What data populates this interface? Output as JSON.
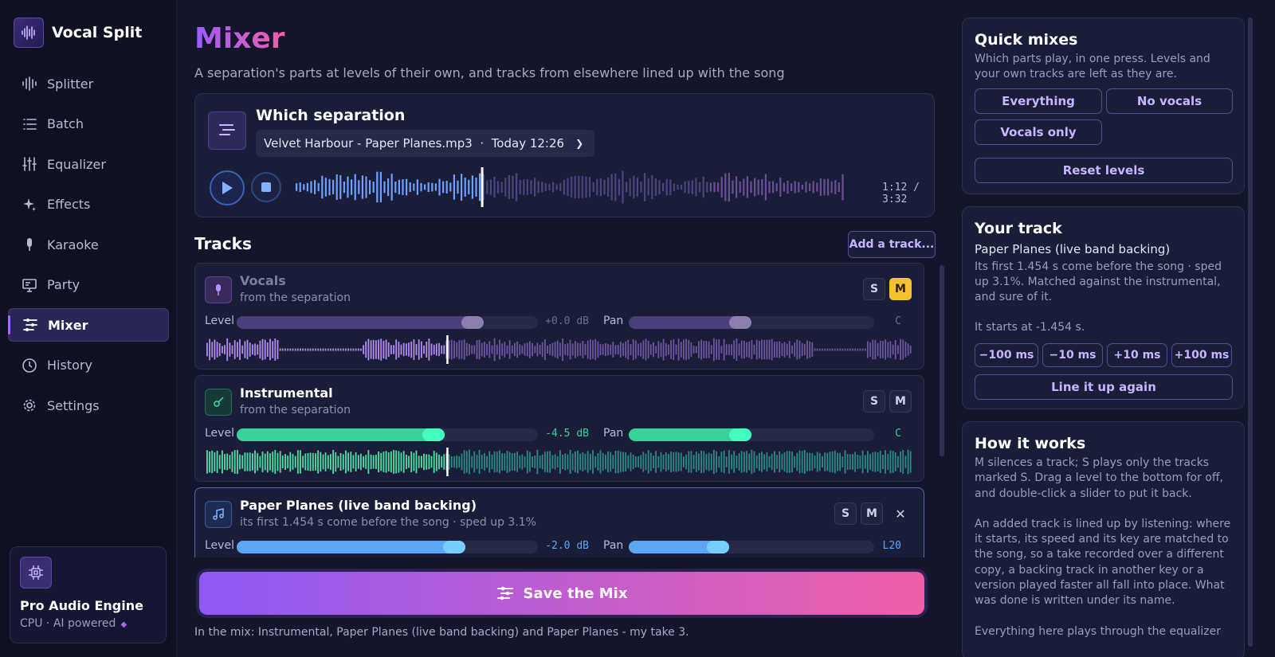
{
  "app": {
    "name": "Vocal Split"
  },
  "nav": [
    {
      "label": "Splitter",
      "icon": "waveform-icon"
    },
    {
      "label": "Batch",
      "icon": "list-icon"
    },
    {
      "label": "Equalizer",
      "icon": "sliders-icon"
    },
    {
      "label": "Effects",
      "icon": "sparkle-icon"
    },
    {
      "label": "Karaoke",
      "icon": "microphone-icon"
    },
    {
      "label": "Party",
      "icon": "monitor-icon"
    },
    {
      "label": "Mixer",
      "icon": "mixer-icon",
      "active": true
    },
    {
      "label": "History",
      "icon": "clock-icon"
    },
    {
      "label": "Settings",
      "icon": "gear-icon"
    }
  ],
  "engine": {
    "title": "Pro Audio Engine",
    "subtitle": "CPU · AI powered",
    "icon": "chip-icon"
  },
  "page": {
    "title": "Mixer",
    "subtitle": "A separation's parts at levels of their own, and tracks from elsewhere lined up with the song"
  },
  "separation": {
    "heading": "Which separation",
    "selected": "Velvet Harbour - Paper Planes.mp3  ·  Today 12:26",
    "time": "1:12 / 3:32",
    "progress": 0.34
  },
  "tracks_section": {
    "heading": "Tracks",
    "add_label": "Add a track..."
  },
  "tracks": [
    {
      "name": "Vocals",
      "sub": "from the separation",
      "level_label": "Level",
      "level": 0.82,
      "level_text": "+0.0 dB",
      "pan_label": "Pan",
      "pan": 0.5,
      "pan_text": "C",
      "solo": "S",
      "mute": "M",
      "muted": true,
      "color": "#7c62b8"
    },
    {
      "name": "Instrumental",
      "sub": "from the separation",
      "level_label": "Level",
      "level": 0.69,
      "level_text": "-4.5 dB",
      "pan_label": "Pan",
      "pan": 0.5,
      "pan_text": "C",
      "solo": "S",
      "mute": "M",
      "muted": false,
      "color": "#34d39a"
    },
    {
      "name": "Paper Planes (live band backing)",
      "sub": "its first 1.454 s come before the song · sped up 3.1%",
      "level_label": "Level",
      "level": 0.76,
      "level_text": "-2.0 dB",
      "pan_label": "Pan",
      "pan": 0.41,
      "pan_text": "L20",
      "solo": "S",
      "mute": "M",
      "remove": "✕",
      "muted": false,
      "color": "#5ea6f5"
    }
  ],
  "save": {
    "label": "Save the Mix"
  },
  "in_mix": "In the mix: Instrumental, Paper Planes (live band backing) and Paper Planes - my take 3.",
  "quick_mixes": {
    "heading": "Quick mixes",
    "desc": "Which parts play, in one press. Levels and your own tracks are left as they are.",
    "buttons": [
      "Everything",
      "No vocals",
      "Vocals only"
    ],
    "reset": "Reset levels"
  },
  "your_track": {
    "heading": "Your track",
    "name": "Paper Planes (live band backing)",
    "desc": "Its first 1.454 s come before the song · sped up 3.1%. Matched against the instrumental, and sure of it.",
    "starts": "It starts at -1.454 s.",
    "nudges": [
      "−100 ms",
      "−10 ms",
      "+10 ms",
      "+100 ms"
    ],
    "realign": "Line it up again"
  },
  "how_it_works": {
    "heading": "How it works",
    "p1": "M silences a track; S plays only the tracks marked S. Drag a level to the bottom for off, and double-click a slider to put it back.",
    "p2": "An added track is lined up by listening: where it starts, its speed and its key are matched to the song, so a take recorded over a different copy, a backing track in another key or a version played faster all fall into place. What was done is written under its name.",
    "p3": "Everything here plays through the equalizer"
  }
}
